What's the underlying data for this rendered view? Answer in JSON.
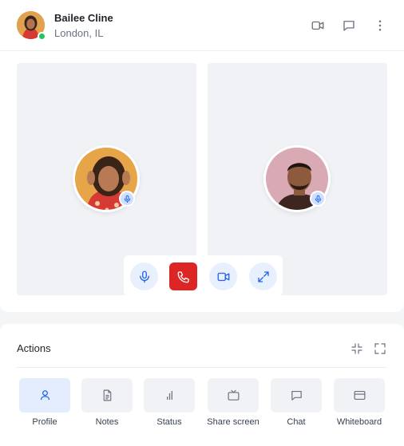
{
  "header": {
    "name": "Bailee Cline",
    "location": "London, IL",
    "icons": [
      "video-camera-icon",
      "chat-bubble-icon",
      "more-vertical-icon"
    ]
  },
  "participants": [
    {
      "avatar": "female-portrait",
      "mic": "microphone-icon"
    },
    {
      "avatar": "male-portrait",
      "mic": "microphone-icon"
    }
  ],
  "controls": {
    "items": [
      "microphone-icon",
      "phone-end-icon",
      "video-camera-icon",
      "expand-icon"
    ],
    "colors": {
      "primary": "#2563eb",
      "danger": "#dc2626",
      "online": "#22c55e"
    }
  },
  "actions": {
    "title": "Actions",
    "header_icons": [
      "collapse-icon",
      "fullscreen-icon"
    ],
    "items": [
      {
        "label": "Profile",
        "icon": "user-icon",
        "active": true
      },
      {
        "label": "Notes",
        "icon": "document-icon",
        "active": false
      },
      {
        "label": "Status",
        "icon": "bar-chart-icon",
        "active": false
      },
      {
        "label": "Share screen",
        "icon": "tv-icon",
        "active": false
      },
      {
        "label": "Chat",
        "icon": "chat-bubble-icon",
        "active": false
      },
      {
        "label": "Whiteboard",
        "icon": "whiteboard-icon",
        "active": false
      }
    ]
  }
}
